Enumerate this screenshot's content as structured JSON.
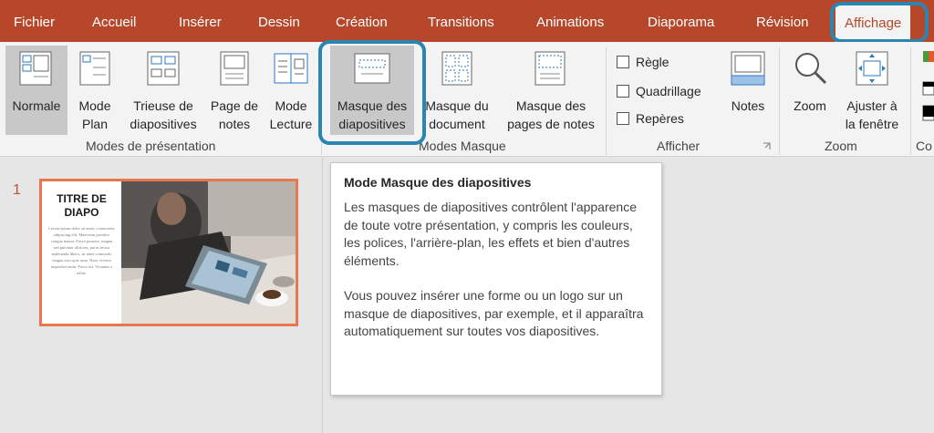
{
  "menu": {
    "tabs": [
      "Fichier",
      "Accueil",
      "Insérer",
      "Dessin",
      "Création",
      "Transitions",
      "Animations",
      "Diaporama",
      "Révision",
      "Affichage"
    ],
    "active": "Affichage"
  },
  "ribbon": {
    "normale": "Normale",
    "mode_plan": [
      "Mode",
      "Plan"
    ],
    "trieuse": [
      "Trieuse de",
      "diapositives"
    ],
    "page_notes": [
      "Page de",
      "notes"
    ],
    "mode_lecture": [
      "Mode",
      "Lecture"
    ],
    "masque_diapo": [
      "Masque des",
      "diapositives"
    ],
    "masque_document": [
      "Masque du",
      "document"
    ],
    "masque_notes": [
      "Masque des",
      "pages de notes"
    ],
    "regle": "Règle",
    "quadrillage": "Quadrillage",
    "reperes": "Repères",
    "notes": "Notes",
    "zoom": "Zoom",
    "ajuster": [
      "Ajuster à",
      "la fenêtre"
    ],
    "groups": {
      "modes_presentation": "Modes de présentation",
      "modes_masque": "Modes Masque",
      "afficher": "Afficher",
      "zoom": "Zoom",
      "couleur": "Co"
    }
  },
  "slides": {
    "number": "1",
    "title": "TITRE DE DIAPO",
    "body": "Lorem ipsum dolor sit amet, consectetur adipiscing elit. Maecenas porttitor congue massa. Fusce posuere, magna sed pulvinar ultricies, purus lectus malesuada libero, sit amet commodo magna eros quis urna. Nunc viverra imperdiet enim. Fusce est. Vivamus a tellus."
  },
  "tooltip": {
    "title": "Mode Masque des diapositives",
    "p1": "Les masques de diapositives contrôlent l'apparence de toute votre présentation, y compris les couleurs, les polices, l'arrière-plan, les effets et bien d'autres éléments.",
    "p2": "Vous pouvez insérer une forme ou un logo sur un masque de diapositives, par exemple, et il apparaîtra automatiquement sur toutes vos diapositives."
  },
  "colors": {
    "accent": "#b7472a",
    "highlight": "#2a86b0",
    "thumb_border": "#e8774f"
  }
}
